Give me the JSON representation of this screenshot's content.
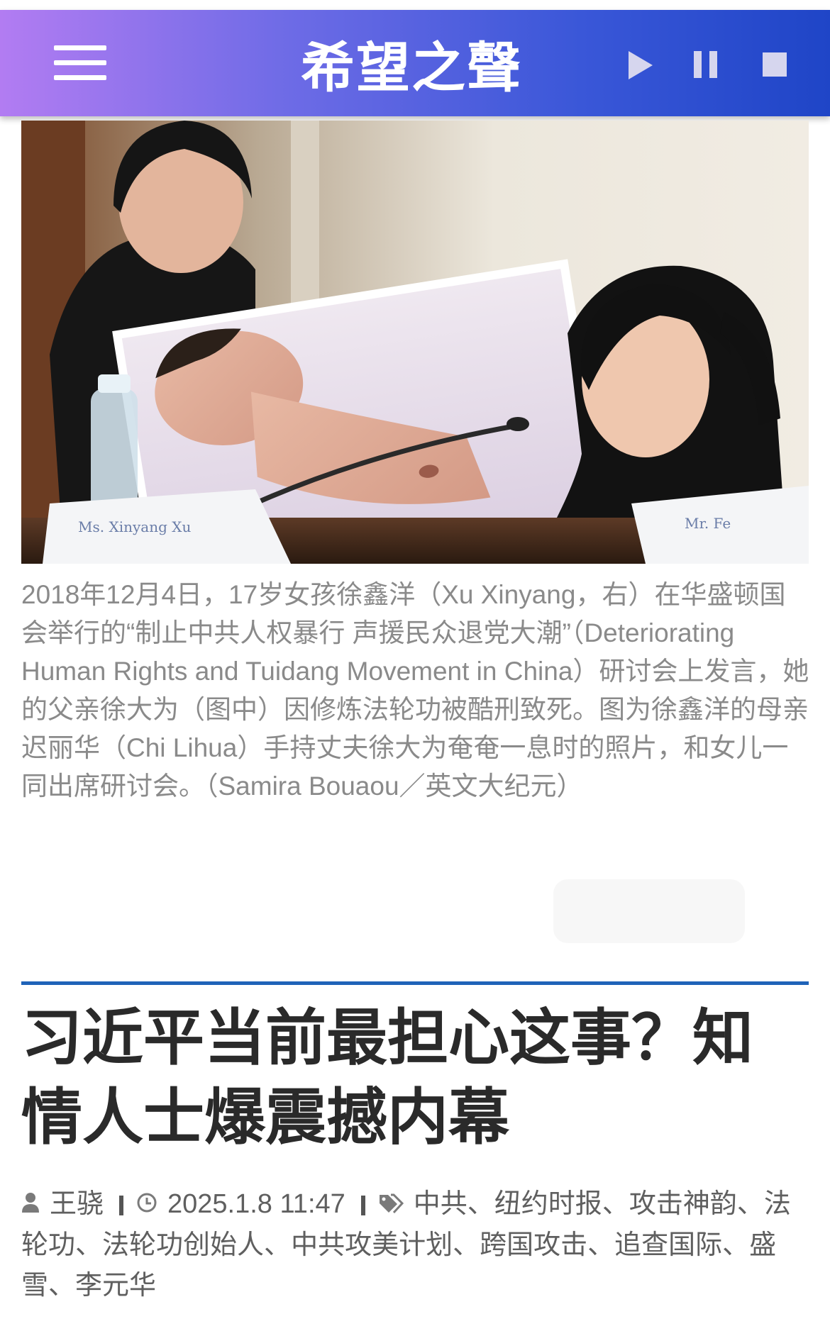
{
  "header": {
    "logo_text": "希望之聲",
    "icons": [
      "menu-icon",
      "play-icon",
      "pause-icon",
      "stop-icon"
    ]
  },
  "photo": {
    "placard_left_text": "Ms. Xinyang Xu",
    "placard_right_text": "Mr. Fe"
  },
  "caption": {
    "text": "2018年12月4日，17岁女孩徐鑫洋（Xu Xinyang，右）在华盛顿国会举行的“制止中共人权暴行 声援民众退党大潮”（Deteriorating Human Rights and Tuidang Movement in China）研讨会上发言，她的父亲徐大为（图中）因修炼法轮功被酷刑致死。图为徐鑫洋的母亲迟丽华（Chi Lihua）手持丈夫徐大为奄奄一息时的照片，和女儿一同出席研讨会。（Samira Bouaou／英文大纪元）"
  },
  "article": {
    "title": "习近平当前最担心这事？知情人士爆震撼内幕",
    "author": "王骁",
    "datetime": "2025.1.8 11:47",
    "tags": [
      "中共",
      "纽约时报",
      "攻击神韵",
      "法轮功",
      "法轮功创始人",
      "中共攻美计划",
      "跨国攻击",
      "追查国际",
      "盛雪",
      "李元华"
    ],
    "tag_separator": "、"
  },
  "colors": {
    "header_gradient_start": "#b27cf2",
    "header_gradient_end": "#1f45c7",
    "divider": "#1f63b8",
    "caption_text": "#8a8a8a",
    "title_text": "#2a2a2a",
    "meta_text": "#5f5f5f"
  }
}
